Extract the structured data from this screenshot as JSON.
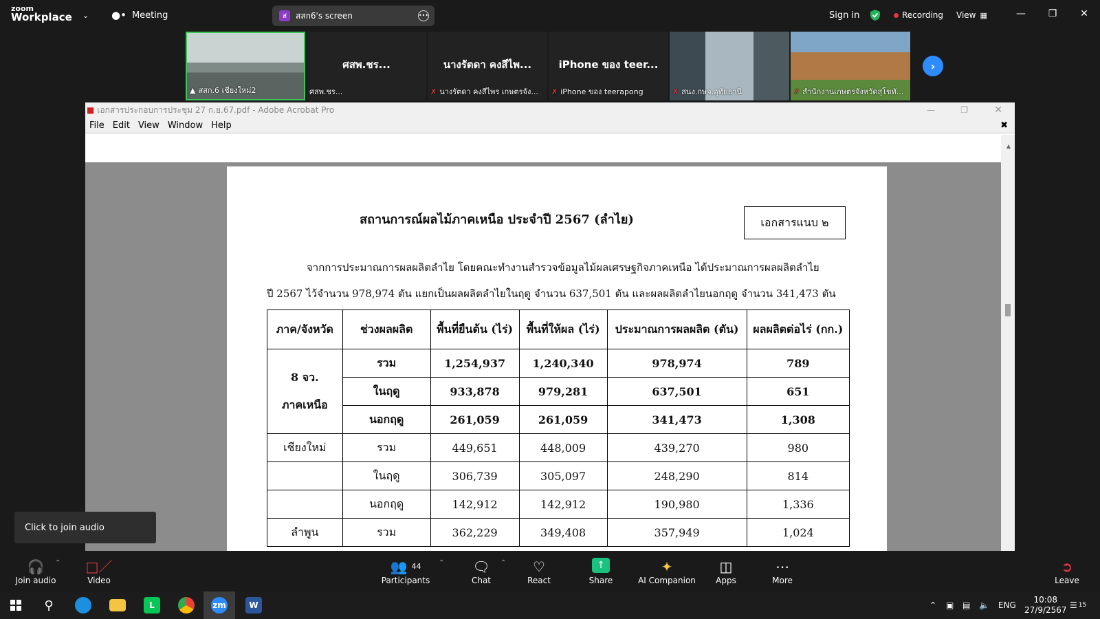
{
  "zoom": {
    "logo_top": "zoom",
    "logo_bottom": "Workplace",
    "meeting_label": "Meeting",
    "screen_share_label": "สสก6's screen",
    "screen_share_avatar": "ส",
    "sign_in": "Sign in",
    "recording": "Recording",
    "view": "View"
  },
  "participants_strip": [
    {
      "label": "สสก.6 เชียงใหม่2",
      "big": ""
    },
    {
      "label": "ศสพ.ชร...",
      "big": "ศสพ.ชร..."
    },
    {
      "label": "นางรัตดา คงสีไพร เกษตรจัง...",
      "big": "นางรัตดา คงสีไพ..."
    },
    {
      "label": "iPhone ของ teerapong",
      "big": "iPhone ของ teer..."
    },
    {
      "label": "สนง.กษจ.อุทัยธานี",
      "big": ""
    },
    {
      "label": "สำนักงานเกษตรจังหวัดสุโขทั...",
      "big": ""
    }
  ],
  "acrobat": {
    "title": "เอกสารประกอบการประชุม 27 ก.ย.67.pdf - Adobe Acrobat Pro",
    "menu": [
      "File",
      "Edit",
      "View",
      "Window",
      "Help"
    ]
  },
  "document": {
    "title": "สถานการณ์ผลไม้ภาคเหนือ ประจำปี 2567 (ลำไย)",
    "attachment": "เอกสารแนบ ๒",
    "para_line1": "จากการประมาณการผลผลิตลำไย โดยคณะทำงานสำรวจข้อมูลไม้ผลเศรษฐกิจภาคเหนือ ได้ประมาณการผลผลิตลำไย",
    "para_line2": "ปี 2567 ไว้จำนวน 978,974 ตัน แยกเป็นผลผลิตลำไยในฤดู จำนวน 637,501 ตัน และผลผลิตลำไยนอกฤดู จำนวน 341,473 ตัน",
    "table": {
      "headers": [
        "ภาค/จังหวัด",
        "ช่วงผลผลิต",
        "พื้นที่ยืนต้น (ไร่)",
        "พื้นที่ให้ผล (ไร่)",
        "ประมาณการผลผลิต (ตัน)",
        "ผลผลิตต่อไร่ (กก.)"
      ],
      "region_line1": "8 จว.",
      "region_line2": "ภาคเหนือ",
      "rows": [
        {
          "region": "",
          "period": "รวม",
          "planted": "1,254,937",
          "bearing": "1,240,340",
          "output": "978,974",
          "yield": "789"
        },
        {
          "region": "",
          "period": "ในฤดู",
          "planted": "933,878",
          "bearing": "979,281",
          "output": "637,501",
          "yield": "651"
        },
        {
          "region": "",
          "period": "นอกฤดู",
          "planted": "261,059",
          "bearing": "261,059",
          "output": "341,473",
          "yield": "1,308"
        },
        {
          "region": "เชียงใหม่",
          "period": "รวม",
          "planted": "449,651",
          "bearing": "448,009",
          "output": "439,270",
          "yield": "980"
        },
        {
          "region": "",
          "period": "ในฤดู",
          "planted": "306,739",
          "bearing": "305,097",
          "output": "248,290",
          "yield": "814"
        },
        {
          "region": "",
          "period": "นอกฤดู",
          "planted": "142,912",
          "bearing": "142,912",
          "output": "190,980",
          "yield": "1,336"
        },
        {
          "region": "ลำพูน",
          "period": "รวม",
          "planted": "362,229",
          "bearing": "349,408",
          "output": "357,949",
          "yield": "1,024"
        }
      ]
    }
  },
  "toast": "Click to join audio",
  "toolbar": {
    "join_audio": "Join audio",
    "video": "Video",
    "participants": "Participants",
    "participants_count": "44",
    "chat": "Chat",
    "react": "React",
    "share": "Share",
    "ai": "AI Companion",
    "apps": "Apps",
    "more": "More",
    "leave": "Leave"
  },
  "taskbar": {
    "lang": "ENG",
    "time": "10:08",
    "date": "27/9/2567",
    "notif_count": "15"
  }
}
